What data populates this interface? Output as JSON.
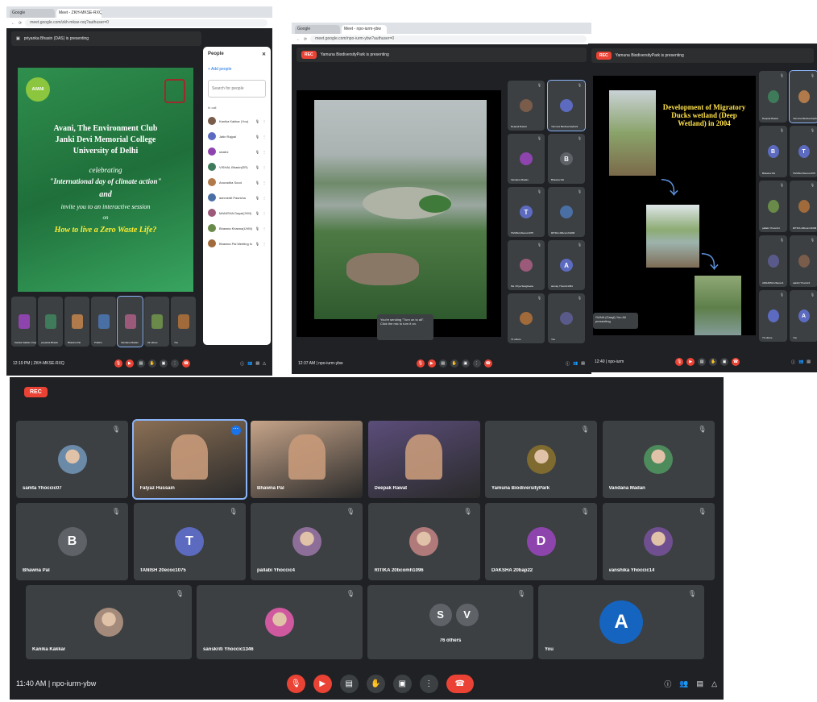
{
  "shot1": {
    "tabs": [
      "Google",
      "Meet - ZKH-MKSE-RXQ"
    ],
    "url": "meet.google.com/zkh-mkse-rxq?authuser=0",
    "presenter": "priyanka Bhasin (DAS) is presenting",
    "slide": {
      "logo_text": "AVANI",
      "line1": "Avani, The Environment Club",
      "line2": "Janki Devi Memorial College",
      "line3": "University of Delhi",
      "line4": "celebrating",
      "line5": "\"International day of climate action\"",
      "line6": "and",
      "line7": "invite you to an interactive session",
      "line8": "on",
      "line9": "How to live a Zero Waste Life?"
    },
    "people_panel": {
      "title": "People",
      "add": "Add people",
      "search": "Search for people",
      "section": "In call",
      "people": [
        "Kanika Kakkar (You)",
        "Jatin Rajpal",
        "shalini",
        "VISHAL Bhasin(ER)",
        "Anuradha Sood",
        "ashmedit Pasricha",
        "MANISHA Dayal(JVM)",
        "Bhawna Khanna(UVM)",
        "Bhawna Pal Meeting host"
      ]
    },
    "tiles": [
      "Kanika Kakkar (You)",
      "priyanka Bhasin",
      "Bhawna Pal",
      "Prabhu",
      "Vandana Madan",
      "22 others",
      "You"
    ],
    "time": "12:19 PM | ZKH-MKSE-RXQ"
  },
  "shot2": {
    "tabs": [
      "Google",
      "Meet - npo-iurm-ybw"
    ],
    "url": "meet.google.com/npo-iurm-ybw?authuser=0",
    "presenter": "Yamuna BiodiversityPark is presenting",
    "tiles": [
      "Deepak Rawat",
      "Yamuna BiodiversityPark",
      "Vandana Madan",
      "Bhawna Pal",
      "TANISH 20ecoc1075",
      "RITIKA 20bcomh1096",
      "Ms. Priya Sangheeta",
      "anmay Yhoccic1091",
      "71 others",
      "You"
    ],
    "tooltip": "You're sending \"Turn on to all\". Click the mic to turn it on.",
    "time": "12:37 AM | npo-iurm-ybw"
  },
  "shot3": {
    "presenter": "Yamuna BiodiversityPark is presenting",
    "slide_title": "Development of Migratory Ducks wetland (Deep Wetland) in 2004",
    "self_label": "GANA (Gargi) You All presenting",
    "tiles": [
      "Deepak Rawat",
      "Yamuna BiodiversityPark",
      "Bhawna Pal",
      "TANISH 20ecoc1075",
      "pallabi Yhoccic4",
      "RITIKA 20bcomh1096",
      "ANNAPRA 20ecoc1",
      "sakshi Yhoccic4",
      "72 others",
      "You"
    ],
    "time": "12:40 | npo-iurm"
  },
  "big": {
    "rec": "REC",
    "tiles": [
      {
        "name": "samta Yhoccic07",
        "kind": "photo",
        "color": "#6a8aa8"
      },
      {
        "name": "Falyaz Hussain",
        "kind": "video",
        "color": "#8a6f55"
      },
      {
        "name": "Bhawna Pal",
        "kind": "video",
        "color": "#c6a489"
      },
      {
        "name": "Deepak Rawat",
        "kind": "video",
        "color": "#5b4d7a"
      },
      {
        "name": "Yamuna BiodiversityPark",
        "kind": "photo",
        "color": "#7f6a2f"
      },
      {
        "name": "Vandana Madan",
        "kind": "photo",
        "color": "#4d8a5c"
      },
      {
        "name": "Bhawna Pal",
        "kind": "letter",
        "letter": "B",
        "color": "#5f6368"
      },
      {
        "name": "TANISH 20ecoc1075",
        "kind": "letter",
        "letter": "T",
        "color": "#5c6bc0"
      },
      {
        "name": "pallabi Yhoccic4",
        "kind": "photo",
        "color": "#8d6e99"
      },
      {
        "name": "RITIKA 20bcomh1096",
        "kind": "photo",
        "color": "#b07a7a"
      },
      {
        "name": "DAKSHA 20bap22",
        "kind": "letter",
        "letter": "D",
        "color": "#8e44ad"
      },
      {
        "name": "vanshika Yhoccic14",
        "kind": "photo",
        "color": "#6f4f8f"
      },
      {
        "name": "Kanika Kakkar",
        "kind": "photo",
        "color": "#a38a7a"
      },
      {
        "name": "sanskriti Yhoccic1346",
        "kind": "photo",
        "color": "#d0589f"
      },
      {
        "name": "76 others",
        "kind": "others",
        "letters": [
          "S",
          "V"
        ]
      },
      {
        "name": "You",
        "kind": "letter",
        "letter": "A",
        "color": "#1565c0"
      }
    ],
    "time": "11:40 AM  |  npo-iurm-ybw"
  }
}
